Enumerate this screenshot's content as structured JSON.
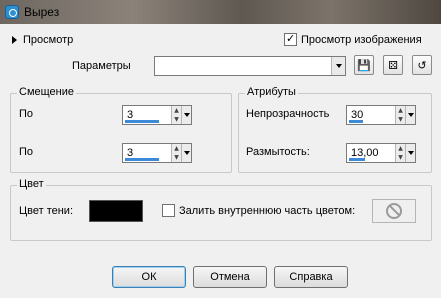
{
  "window": {
    "title": "Вырез"
  },
  "preview": {
    "toggle_label": "Просмотр",
    "image_preview_label": "Просмотр изображения",
    "image_preview_checked": true
  },
  "params": {
    "label": "Параметры",
    "value": ""
  },
  "offset": {
    "title": "Смещение",
    "rows": [
      {
        "label": "По",
        "value": "3",
        "fill": 0.85
      },
      {
        "label": "По",
        "value": "3",
        "fill": 0.85
      }
    ]
  },
  "attributes": {
    "title": "Атрибуты",
    "opacity_label": "Непрозрачность",
    "opacity_value": "30",
    "opacity_fill": 0.3,
    "blur_label": "Размытость:",
    "blur_value": "13,00",
    "blur_fill": 0.35
  },
  "color": {
    "title": "Цвет",
    "shadow_label": "Цвет тени:",
    "shadow_color": "#000000",
    "fill_inner_label": "Залить внутреннюю часть цветом:",
    "fill_inner_checked": false
  },
  "icons": {
    "save": "save-icon",
    "randomize": "dice-icon",
    "reset": "reset-icon",
    "no_color": "no-color-icon"
  },
  "buttons": {
    "ok": "ОК",
    "cancel": "Отмена",
    "help": "Справка"
  }
}
